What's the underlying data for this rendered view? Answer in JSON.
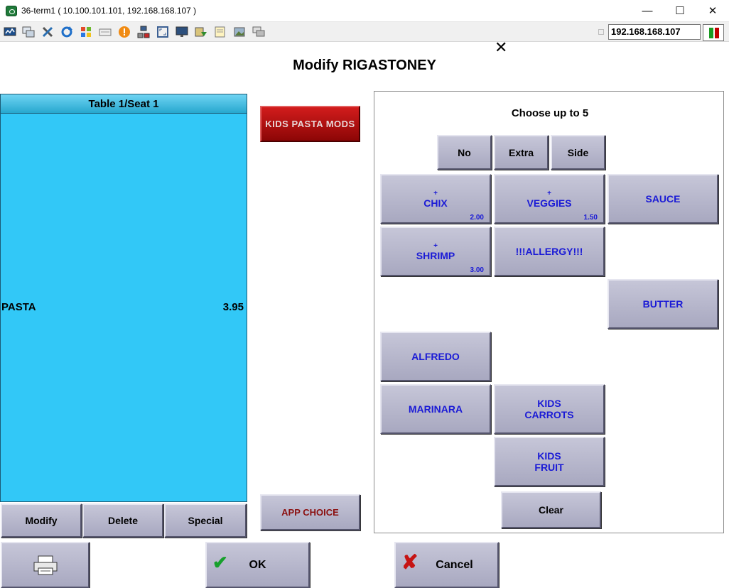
{
  "window": {
    "title": "36-term1 ( 10.100.101.101, 192.168.168.107 )",
    "minimize": "—",
    "maximize": "☐",
    "close": "✕"
  },
  "toolbar": {
    "icons": [
      "monitor-icon",
      "windows-icon",
      "tools-icon",
      "refresh-icon",
      "windows-logo-icon",
      "keyboard-icon",
      "alert-icon",
      "network-icon",
      "fullscreen-icon",
      "display-icon",
      "transfer-icon",
      "notes-icon",
      "screenshot-icon",
      "chat-icon"
    ],
    "ip_value": "192.168.168.107",
    "status_colors": [
      "#1a9a22",
      "#c00000"
    ]
  },
  "dialog": {
    "close": "✕",
    "title": "Modify RIGASTONEY"
  },
  "order": {
    "header": "Table 1/Seat 1",
    "item_name": "PASTA",
    "item_price": "3.95",
    "buttons": {
      "modify": "Modify",
      "delete": "Delete",
      "special": "Special"
    }
  },
  "categories": {
    "kids_pasta_mods": "KIDS PASTA MODS",
    "app_choice": "APP CHOICE"
  },
  "modifiers": {
    "choose_label": "Choose up to 5",
    "prefixes": {
      "no": "No",
      "extra": "Extra",
      "side": "Side"
    },
    "chix": {
      "plus": "+",
      "label": "CHIX",
      "price": "2.00"
    },
    "veggies": {
      "plus": "+",
      "label": "VEGGIES",
      "price": "1.50"
    },
    "sauce": "SAUCE",
    "shrimp": {
      "plus": "+",
      "label": "SHRIMP",
      "price": "3.00"
    },
    "allergy": "!!!ALLERGY!!!",
    "butter": "BUTTER",
    "alfredo": "ALFREDO",
    "marinara": "MARINARA",
    "kids_carrots": {
      "line1": "KIDS",
      "line2": "CARROTS"
    },
    "kids_fruit": {
      "line1": "KIDS",
      "line2": "FRUIT"
    },
    "clear": "Clear"
  },
  "footer": {
    "ok": "OK",
    "cancel": "Cancel"
  }
}
